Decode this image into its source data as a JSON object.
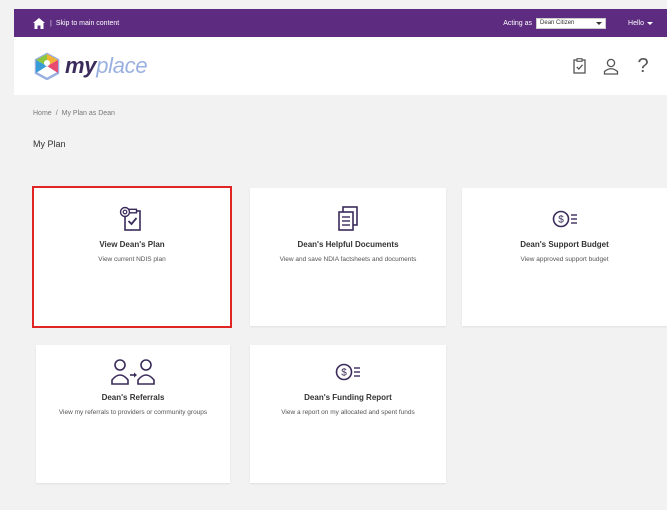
{
  "topbar": {
    "skip_link": "Skip to main content",
    "separator": "|",
    "acting_label": "Acting as",
    "acting_value": "Dean Citizen",
    "hello": "Hello"
  },
  "header": {
    "logo_my": "my",
    "logo_place": "place",
    "help": "?"
  },
  "breadcrumb": {
    "home": "Home",
    "separator": "/",
    "current": "My Plan as Dean"
  },
  "page_title": "My Plan",
  "tiles": [
    {
      "icon": "plan-icon",
      "title": "View Dean's Plan",
      "desc": "View current NDIS plan"
    },
    {
      "icon": "documents-icon",
      "title": "Dean's Helpful Documents",
      "desc": "View and save NDIA factsheets and documents"
    },
    {
      "icon": "budget-icon",
      "title": "Dean's Support Budget",
      "desc": "View approved support budget"
    },
    {
      "icon": "referrals-icon",
      "title": "Dean's Referrals",
      "desc": "View my referrals to providers or community groups"
    },
    {
      "icon": "funding-icon",
      "title": "Dean's Funding Report",
      "desc": "View a report on my allocated and spent funds"
    }
  ],
  "colors": {
    "brand_purple": "#5d2c80",
    "highlight_red": "#e02424",
    "icon_dark": "#3a2b5b"
  }
}
